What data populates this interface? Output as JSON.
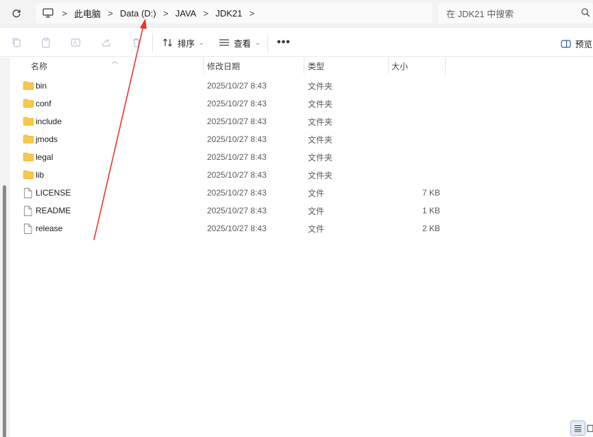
{
  "address_bar": {
    "breadcrumb": [
      "此电脑",
      "Data (D:)",
      "JAVA",
      "JDK21"
    ],
    "separator": ">"
  },
  "search": {
    "placeholder": "在 JDK21 中搜索"
  },
  "toolbar": {
    "sort_label": "排序",
    "view_label": "查看",
    "more_label": "•••",
    "preview_label": "预览"
  },
  "columns": {
    "name": "名称",
    "date": "修改日期",
    "type": "类型",
    "size": "大小"
  },
  "files": [
    {
      "name": "bin",
      "date": "2025/10/27 8:43",
      "type": "文件夹",
      "size": "",
      "kind": "folder"
    },
    {
      "name": "conf",
      "date": "2025/10/27 8:43",
      "type": "文件夹",
      "size": "",
      "kind": "folder"
    },
    {
      "name": "include",
      "date": "2025/10/27 8:43",
      "type": "文件夹",
      "size": "",
      "kind": "folder"
    },
    {
      "name": "jmods",
      "date": "2025/10/27 8:43",
      "type": "文件夹",
      "size": "",
      "kind": "folder"
    },
    {
      "name": "legal",
      "date": "2025/10/27 8:43",
      "type": "文件夹",
      "size": "",
      "kind": "folder"
    },
    {
      "name": "lib",
      "date": "2025/10/27 8:43",
      "type": "文件夹",
      "size": "",
      "kind": "folder"
    },
    {
      "name": "LICENSE",
      "date": "2025/10/27 8:43",
      "type": "文件",
      "size": "7 KB",
      "kind": "file"
    },
    {
      "name": "README",
      "date": "2025/10/27 8:43",
      "type": "文件",
      "size": "1 KB",
      "kind": "file"
    },
    {
      "name": "release",
      "date": "2025/10/27 8:43",
      "type": "文件",
      "size": "2 KB",
      "kind": "file"
    }
  ],
  "colors": {
    "folder": "#f8c84b",
    "folder_dark": "#e6a92a",
    "annotation_arrow": "#e8342a",
    "selection_accent": "#9ab6d8"
  },
  "icons": {
    "refresh": "refresh-icon",
    "computer": "computer-icon",
    "search": "search-icon",
    "sort": "sort-icon",
    "view": "view-icon",
    "preview": "preview-pane-icon"
  }
}
